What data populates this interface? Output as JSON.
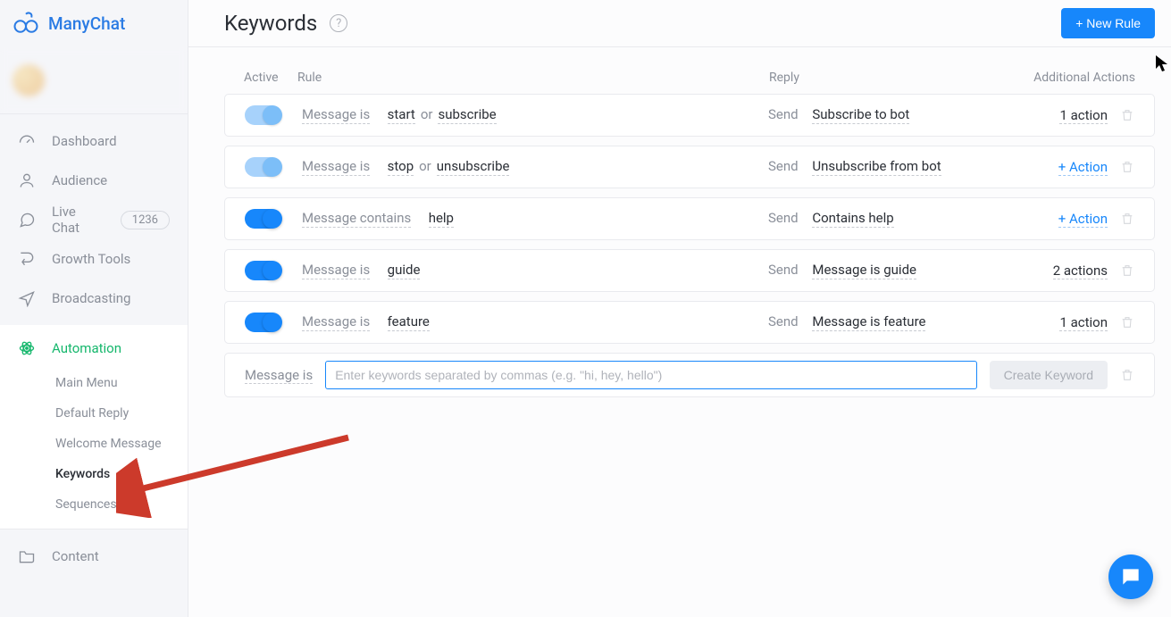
{
  "brand": "ManyChat",
  "header": {
    "title": "Keywords",
    "new_rule_label": "+ New Rule"
  },
  "sidebar": {
    "items": [
      {
        "label": "Dashboard"
      },
      {
        "label": "Audience"
      },
      {
        "label": "Live Chat",
        "badge": "1236"
      },
      {
        "label": "Growth Tools"
      },
      {
        "label": "Broadcasting"
      },
      {
        "label": "Automation",
        "active": true
      },
      {
        "label": "Content"
      }
    ],
    "automation_sub": [
      {
        "label": "Main Menu"
      },
      {
        "label": "Default Reply"
      },
      {
        "label": "Welcome Message"
      },
      {
        "label": "Keywords",
        "current": true
      },
      {
        "label": "Sequences"
      }
    ]
  },
  "columns": {
    "active": "Active",
    "rule": "Rule",
    "reply": "Reply",
    "actions": "Additional Actions"
  },
  "rules": [
    {
      "toggle": "soft",
      "cond": "Message is",
      "kw": "start",
      "or": "or",
      "kw2": "subscribe",
      "send": "Send",
      "reply": "Subscribe to bot",
      "action_text": "1 action"
    },
    {
      "toggle": "soft",
      "cond": "Message is",
      "kw": "stop",
      "or": "or",
      "kw2": "unsubscribe",
      "send": "Send",
      "reply": "Unsubscribe from bot",
      "action_link": "+ Action"
    },
    {
      "toggle": "strong",
      "cond": "Message contains",
      "kw": "help",
      "send": "Send",
      "reply": "Contains help",
      "action_link": "+ Action"
    },
    {
      "toggle": "strong",
      "cond": "Message is",
      "kw": "guide",
      "send": "Send",
      "reply": "Message is guide",
      "action_text": "2 actions"
    },
    {
      "toggle": "strong",
      "cond": "Message is",
      "kw": "feature",
      "send": "Send",
      "reply": "Message is feature",
      "action_text": "1 action"
    }
  ],
  "create": {
    "label": "Message is",
    "placeholder": "Enter keywords separated by commas (e.g. \"hi, hey, hello\")",
    "button": "Create Keyword"
  }
}
